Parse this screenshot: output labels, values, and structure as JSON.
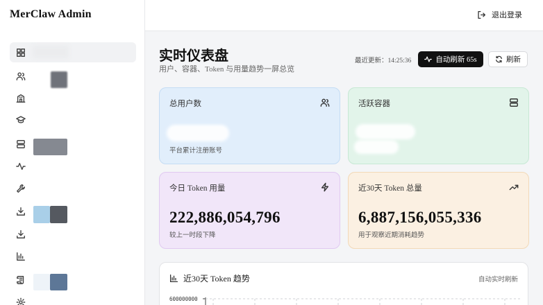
{
  "sidebar": {
    "brand": "MerClaw Admin",
    "icons": [
      "dashboard-icon",
      "users-icon",
      "building-icon",
      "graduation-cap-icon",
      "server-icon",
      "activity-icon",
      "wrench-icon",
      "download-icon",
      "download-icon",
      "bar-chart-icon",
      "scroll-icon",
      "gear-icon"
    ]
  },
  "topbar": {
    "logout_label": "退出登录"
  },
  "header": {
    "title": "实时仪表盘",
    "subtitle": "用户、容器、Token 与用量趋势一屏总览",
    "last_update": "最近更新：14:25:36",
    "auto_refresh_label": "自动刷新 65s",
    "refresh_label": "刷新"
  },
  "cards": {
    "total_users": {
      "title": "总用户数",
      "value": "",
      "note": "平台累计注册账号"
    },
    "active_containers": {
      "title": "活跃容器",
      "value": "",
      "note": ""
    },
    "today_tokens": {
      "title": "今日 Token 用量",
      "value": "222,886,054,796",
      "note": "较上一时段下降"
    },
    "month_tokens": {
      "title": "近30天 Token 总量",
      "value": "6,887,156,055,336",
      "note": "用于观察近期消耗趋势"
    }
  },
  "trend": {
    "title": "近30天 Token 趋势",
    "right_label": "自动实时刷新"
  },
  "chart_data": {
    "type": "line",
    "title": "近30天 Token 趋势",
    "y_tick_labels": [
      "600000000"
    ],
    "series": []
  },
  "colors": {
    "accent": "#111111",
    "card_blue": "#e1eefb",
    "card_green": "#e2f4ea",
    "card_purple": "#f1e6f9",
    "card_orange": "#fbf0e2"
  }
}
